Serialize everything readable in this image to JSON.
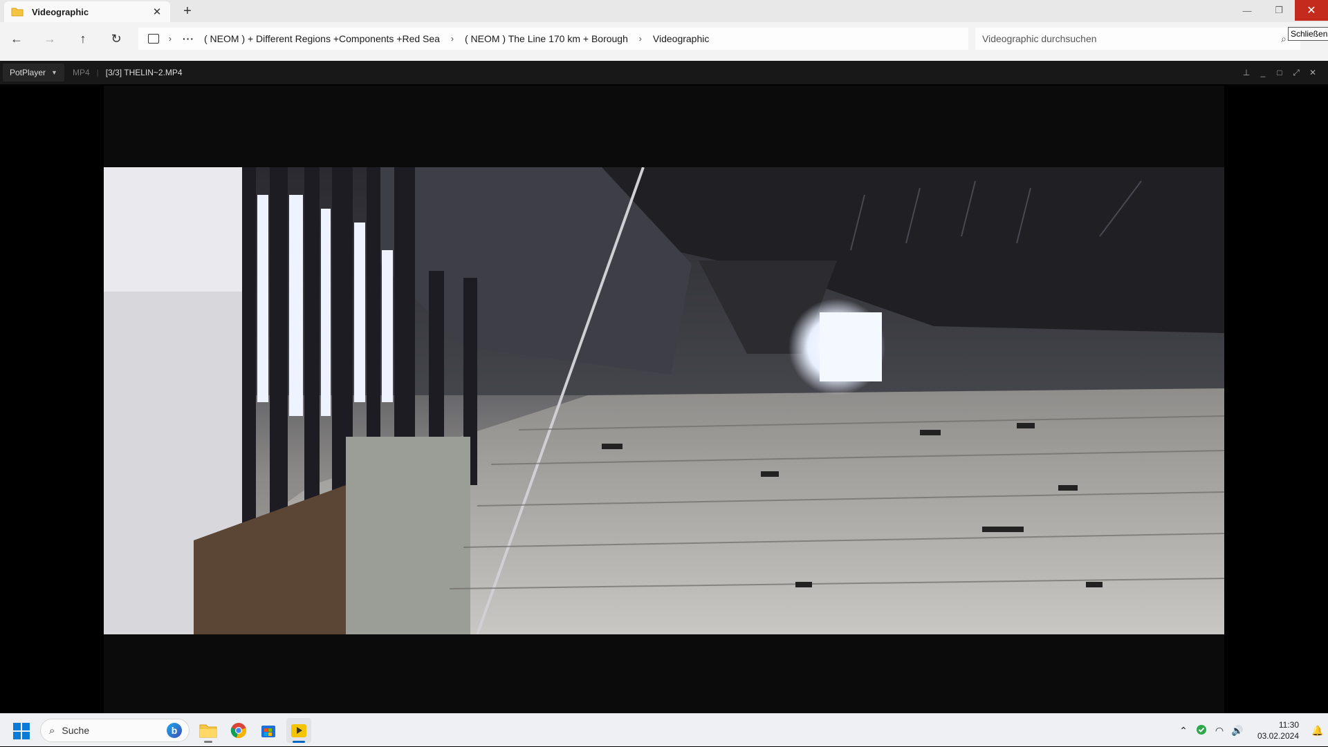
{
  "explorer": {
    "tab_title": "Videographic",
    "tab_close": "✕",
    "new_tab": "+",
    "window": {
      "minimize": "—",
      "restore": "❐",
      "close": "✕"
    },
    "nav": {
      "back": "←",
      "forward": "→",
      "up": "↑",
      "refresh": "↻"
    },
    "breadcrumb": [
      "( NEOM ) + Different Regions +Components +Red Sea",
      "( NEOM ) The Line 170 km + Borough",
      "Videographic"
    ],
    "breadcrumb_more": "···",
    "breadcrumb_sep": "›",
    "search_placeholder": "Videographic durchsuchen",
    "tooltip": "Schließen"
  },
  "player": {
    "menu_label": "PotPlayer",
    "format": "MP4",
    "title": "[3/3] THELIN~2.MP4",
    "controls": {
      "pin": "⊥",
      "minimize": "_",
      "maximize": "□",
      "fullscreen": "⤢",
      "close": "✕"
    }
  },
  "taskbar": {
    "search_label": "Suche",
    "clock_time": "11:30",
    "clock_date": "03.02.2024",
    "tray_chevron": "⌃",
    "volume": "🔊",
    "wifi": "◠",
    "apps": [
      "file-explorer",
      "chrome",
      "microsoft-store",
      "potplayer"
    ]
  },
  "colors": {
    "close_red": "#c42b1c",
    "player_bar": "#181818",
    "taskbar_bg": "#eef0f3",
    "accent": "#0067c0"
  }
}
